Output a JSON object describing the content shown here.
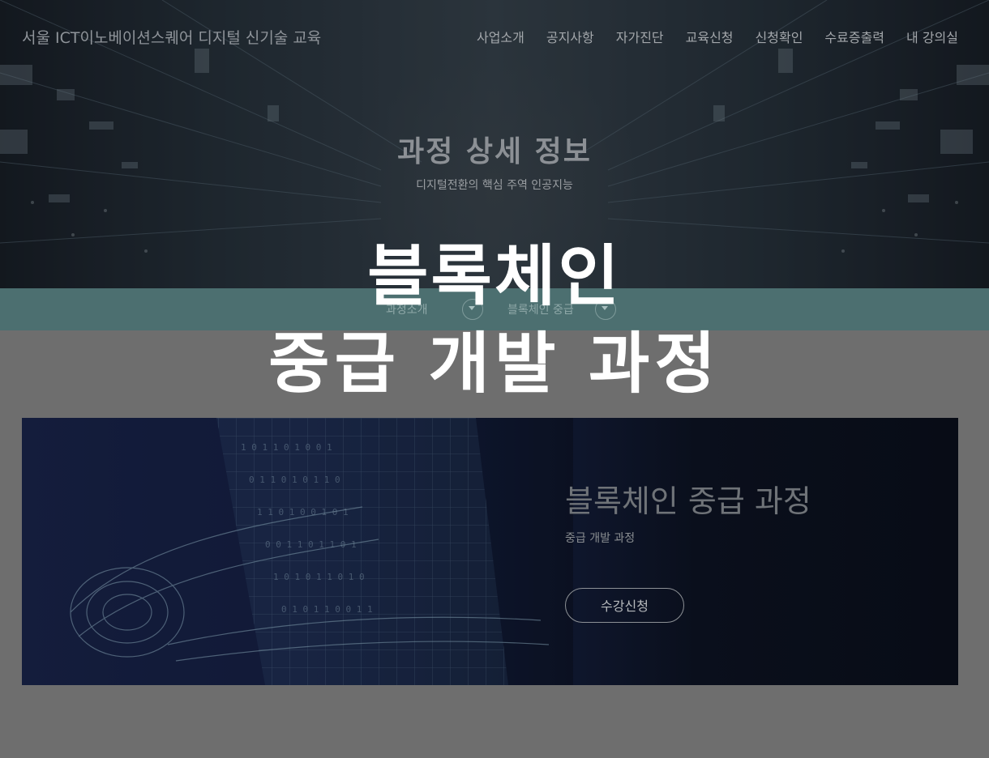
{
  "header": {
    "site_title": "서울 ICT이노베이션스퀘어  디지털 신기술 교육",
    "nav": [
      "사업소개",
      "공지사항",
      "자가진단",
      "교육신청",
      "신청확인",
      "수료증출력",
      "내 강의실"
    ]
  },
  "hero": {
    "title": "과정 상세 정보",
    "subtitle": "디지털전환의 핵심 주역 인공지능"
  },
  "breadcrumb": {
    "items": [
      "과정소개",
      "블록체인 중급"
    ]
  },
  "overlay": {
    "line1": "블록체인",
    "line2": "중급 개발 과정"
  },
  "course": {
    "title": "블록체인 중급 과정",
    "subtitle": "중급 개발 과정",
    "apply_label": "수강신청"
  },
  "colors": {
    "page_background": "#6e6e6e",
    "breadcrumb_bar": "#4c6f70",
    "overlay_text": "#ffffff"
  }
}
